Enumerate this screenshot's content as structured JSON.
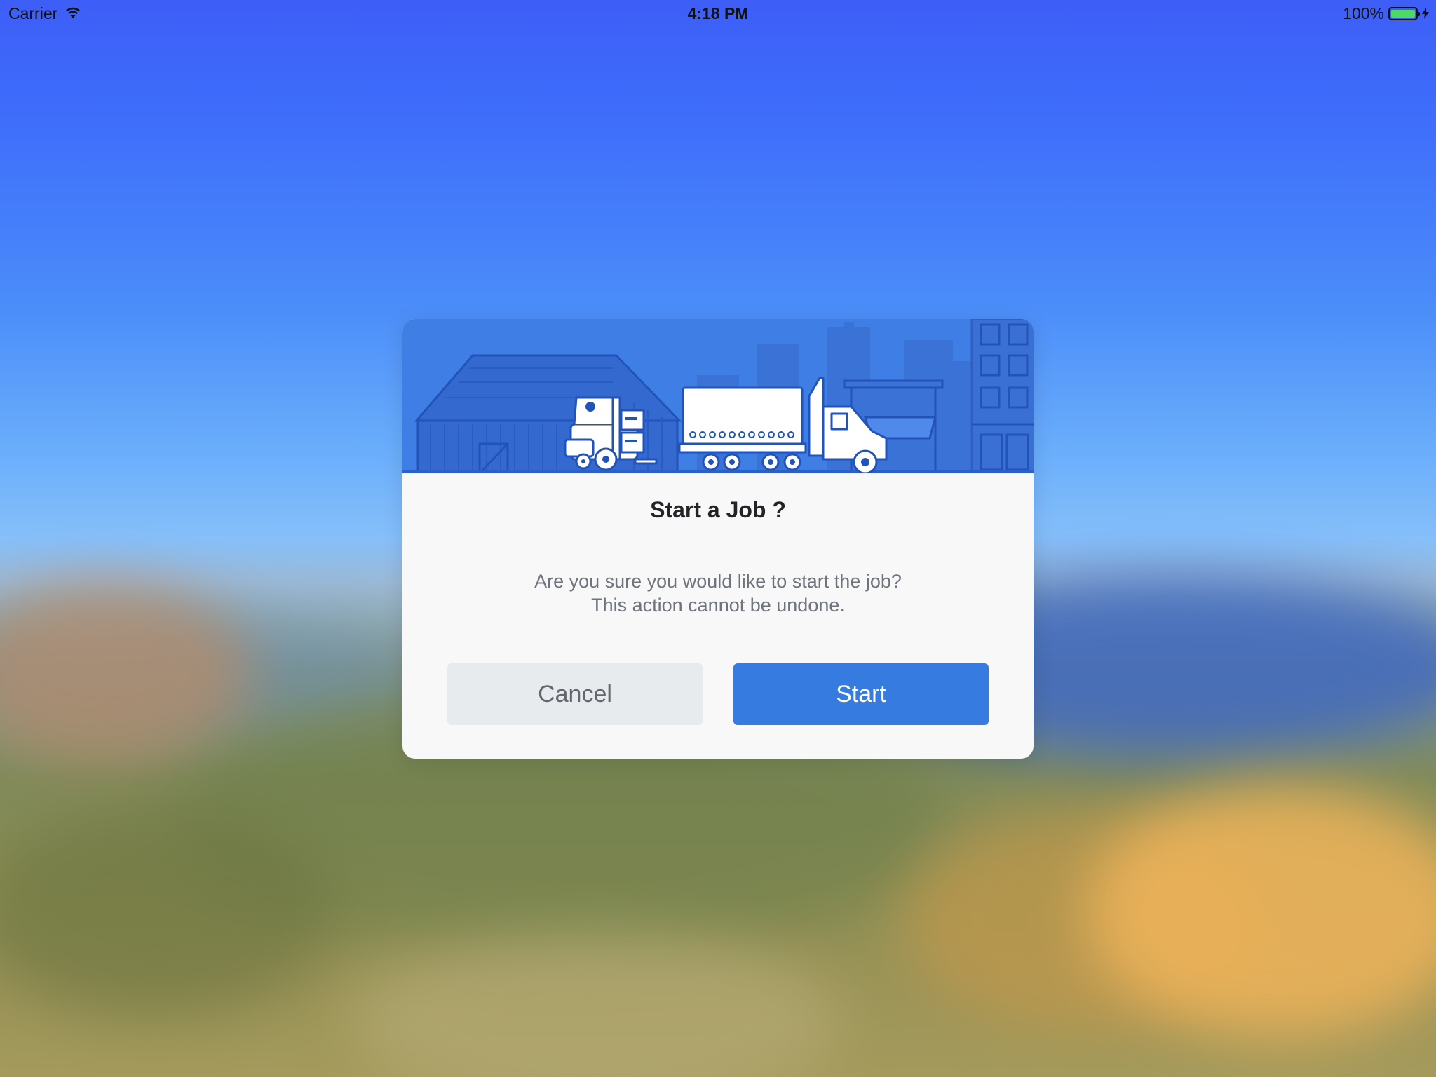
{
  "status_bar": {
    "carrier": "Carrier",
    "time": "4:18 PM",
    "battery_percent": "100%",
    "battery_level": 1.0,
    "icons": [
      "wifi-icon",
      "battery-icon",
      "charging-bolt-icon"
    ]
  },
  "dialog": {
    "illustration": "warehouse-forklift-truck-illustration",
    "title": "Start a Job ?",
    "message": "Are you sure you would like to start the job?\nThis action cannot be undone.",
    "cancel_label": "Cancel",
    "start_label": "Start"
  },
  "colors": {
    "primary": "#357be0",
    "banner": "#3f7ee4",
    "cancel_bg": "#e8ebee",
    "dialog_bg": "#f8f8f9",
    "battery_green": "#4cd964"
  }
}
